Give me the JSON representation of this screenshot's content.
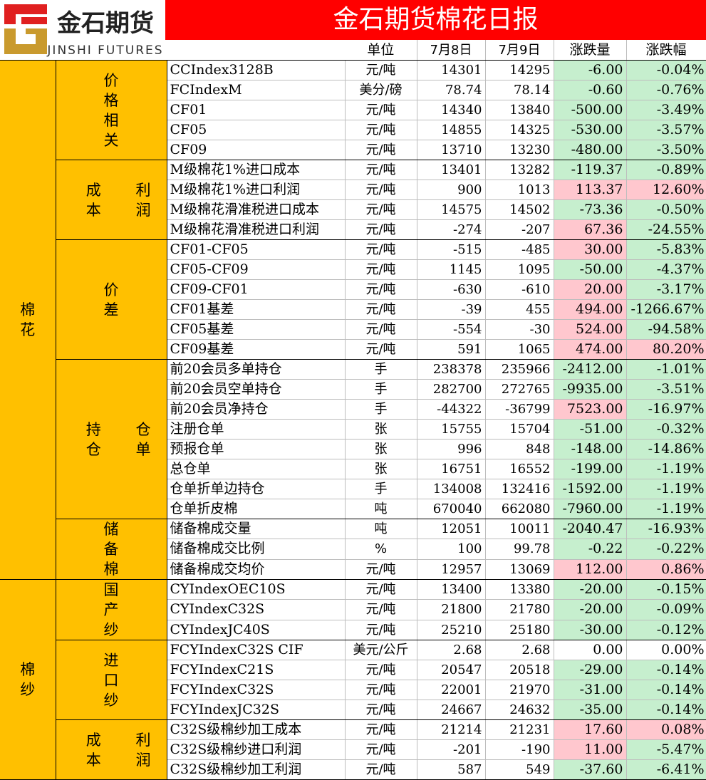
{
  "title": "金石期货棉花日报",
  "logo": {
    "text": "金石期货",
    "sub": "JINSHI FUTURES"
  },
  "colors": {
    "title_bg": "#ff0000",
    "category_bg": "#ffc000",
    "up_bg": "#ffc7ce",
    "down_bg": "#c6efce"
  },
  "headers": {
    "unit": "单位",
    "d1": "7月8日",
    "d2": "7月9日",
    "chg": "涨跌量",
    "pct": "涨跌幅"
  },
  "categories": [
    {
      "label": "棉花",
      "groups": [
        {
          "label": "价格相关",
          "layout": "vertical",
          "rows": [
            {
              "name": "CCIndex3128B",
              "unit": "元/吨",
              "d1": "14301",
              "d2": "14295",
              "chg": "-6.00",
              "pct": "-0.04%",
              "chg_dir": "down",
              "pct_dir": "down"
            },
            {
              "name": "FCIndexM",
              "unit": "美分/磅",
              "d1": "78.74",
              "d2": "78.14",
              "chg": "-0.60",
              "pct": "-0.76%",
              "chg_dir": "down",
              "pct_dir": "down"
            },
            {
              "name": "CF01",
              "unit": "元/吨",
              "d1": "14340",
              "d2": "13840",
              "chg": "-500.00",
              "pct": "-3.49%",
              "chg_dir": "down",
              "pct_dir": "down"
            },
            {
              "name": "CF05",
              "unit": "元/吨",
              "d1": "14855",
              "d2": "14325",
              "chg": "-530.00",
              "pct": "-3.57%",
              "chg_dir": "down",
              "pct_dir": "down"
            },
            {
              "name": "CF09",
              "unit": "元/吨",
              "d1": "13710",
              "d2": "13230",
              "chg": "-480.00",
              "pct": "-3.50%",
              "chg_dir": "down",
              "pct_dir": "down"
            }
          ]
        },
        {
          "label": "成利本润",
          "layout": "grid",
          "rows": [
            {
              "name": "M级棉花1%进口成本",
              "unit": "元/吨",
              "d1": "13401",
              "d2": "13282",
              "chg": "-119.37",
              "pct": "-0.89%",
              "chg_dir": "down",
              "pct_dir": "down"
            },
            {
              "name": "M级棉花1%进口利润",
              "unit": "元/吨",
              "d1": "900",
              "d2": "1013",
              "chg": "113.37",
              "pct": "12.60%",
              "chg_dir": "up",
              "pct_dir": "up"
            },
            {
              "name": "M级棉花滑准税进口成本",
              "unit": "元/吨",
              "d1": "14575",
              "d2": "14502",
              "chg": "-73.36",
              "pct": "-0.50%",
              "chg_dir": "down",
              "pct_dir": "down"
            },
            {
              "name": "M级棉花滑准税进口利润",
              "unit": "元/吨",
              "d1": "-274",
              "d2": "-207",
              "chg": "67.36",
              "pct": "-24.55%",
              "chg_dir": "up",
              "pct_dir": "down"
            }
          ]
        },
        {
          "label": "价差",
          "layout": "vertical",
          "rows": [
            {
              "name": "CF01-CF05",
              "unit": "元/吨",
              "d1": "-515",
              "d2": "-485",
              "chg": "30.00",
              "pct": "-5.83%",
              "chg_dir": "up",
              "pct_dir": "down"
            },
            {
              "name": "CF05-CF09",
              "unit": "元/吨",
              "d1": "1145",
              "d2": "1095",
              "chg": "-50.00",
              "pct": "-4.37%",
              "chg_dir": "down",
              "pct_dir": "down"
            },
            {
              "name": "CF09-CF01",
              "unit": "元/吨",
              "d1": "-630",
              "d2": "-610",
              "chg": "20.00",
              "pct": "-3.17%",
              "chg_dir": "up",
              "pct_dir": "down"
            },
            {
              "name": "CF01基差",
              "unit": "元/吨",
              "d1": "-39",
              "d2": "455",
              "chg": "494.00",
              "pct": "-1266.67%",
              "chg_dir": "up",
              "pct_dir": "down"
            },
            {
              "name": "CF05基差",
              "unit": "元/吨",
              "d1": "-554",
              "d2": "-30",
              "chg": "524.00",
              "pct": "-94.58%",
              "chg_dir": "up",
              "pct_dir": "down"
            },
            {
              "name": "CF09基差",
              "unit": "元/吨",
              "d1": "591",
              "d2": "1065",
              "chg": "474.00",
              "pct": "80.20%",
              "chg_dir": "up",
              "pct_dir": "up"
            }
          ]
        },
        {
          "label": "持仓仓单",
          "layout": "grid",
          "rows": [
            {
              "name": "前20会员多单持仓",
              "unit": "手",
              "d1": "238378",
              "d2": "235966",
              "chg": "-2412.00",
              "pct": "-1.01%",
              "chg_dir": "down",
              "pct_dir": "down"
            },
            {
              "name": "前20会员空单持仓",
              "unit": "手",
              "d1": "282700",
              "d2": "272765",
              "chg": "-9935.00",
              "pct": "-3.51%",
              "chg_dir": "down",
              "pct_dir": "down"
            },
            {
              "name": "前20会员净持仓",
              "unit": "手",
              "d1": "-44322",
              "d2": "-36799",
              "chg": "7523.00",
              "pct": "-16.97%",
              "chg_dir": "up",
              "pct_dir": "down"
            },
            {
              "name": "注册仓单",
              "unit": "张",
              "d1": "15755",
              "d2": "15704",
              "chg": "-51.00",
              "pct": "-0.32%",
              "chg_dir": "down",
              "pct_dir": "down"
            },
            {
              "name": "预报仓单",
              "unit": "张",
              "d1": "996",
              "d2": "848",
              "chg": "-148.00",
              "pct": "-14.86%",
              "chg_dir": "down",
              "pct_dir": "down"
            },
            {
              "name": "总仓单",
              "unit": "张",
              "d1": "16751",
              "d2": "16552",
              "chg": "-199.00",
              "pct": "-1.19%",
              "chg_dir": "down",
              "pct_dir": "down"
            },
            {
              "name": "仓单折单边持仓",
              "unit": "手",
              "d1": "134008",
              "d2": "132416",
              "chg": "-1592.00",
              "pct": "-1.19%",
              "chg_dir": "down",
              "pct_dir": "down"
            },
            {
              "name": "仓单折皮棉",
              "unit": "吨",
              "d1": "670040",
              "d2": "662080",
              "chg": "-7960.00",
              "pct": "-1.19%",
              "chg_dir": "down",
              "pct_dir": "down"
            }
          ]
        },
        {
          "label": "储备棉",
          "layout": "vertical",
          "rows": [
            {
              "name": "储备棉成交量",
              "unit": "吨",
              "d1": "12051",
              "d2": "10011",
              "chg": "-2040.47",
              "pct": "-16.93%",
              "chg_dir": "down",
              "pct_dir": "down"
            },
            {
              "name": "储备棉成交比例",
              "unit": "%",
              "d1": "100",
              "d2": "99.78",
              "chg": "-0.22",
              "pct": "-0.22%",
              "chg_dir": "down",
              "pct_dir": "down"
            },
            {
              "name": "储备棉成交均价",
              "unit": "元/吨",
              "d1": "12957",
              "d2": "13069",
              "chg": "112.00",
              "pct": "0.86%",
              "chg_dir": "up",
              "pct_dir": "up"
            }
          ]
        }
      ]
    },
    {
      "label": "棉纱",
      "groups": [
        {
          "label": "国产纱",
          "layout": "vertical",
          "rows": [
            {
              "name": "CYIndexOEC10S",
              "unit": "元/吨",
              "d1": "13400",
              "d2": "13380",
              "chg": "-20.00",
              "pct": "-0.15%",
              "chg_dir": "down",
              "pct_dir": "down"
            },
            {
              "name": "CYIndexC32S",
              "unit": "元/吨",
              "d1": "21800",
              "d2": "21780",
              "chg": "-20.00",
              "pct": "-0.09%",
              "chg_dir": "down",
              "pct_dir": "down"
            },
            {
              "name": "CYIndexJC40S",
              "unit": "元/吨",
              "d1": "25210",
              "d2": "25180",
              "chg": "-30.00",
              "pct": "-0.12%",
              "chg_dir": "down",
              "pct_dir": "down"
            }
          ]
        },
        {
          "label": "进口纱",
          "layout": "vertical",
          "rows": [
            {
              "name": "FCYIndexC32S CIF",
              "unit": "美元/公斤",
              "d1": "2.68",
              "d2": "2.68",
              "chg": "0.00",
              "pct": "0.00%",
              "chg_dir": "none",
              "pct_dir": "none"
            },
            {
              "name": "FCYIndexC21S",
              "unit": "元/吨",
              "d1": "20547",
              "d2": "20518",
              "chg": "-29.00",
              "pct": "-0.14%",
              "chg_dir": "down",
              "pct_dir": "down"
            },
            {
              "name": "FCYIndexC32S",
              "unit": "元/吨",
              "d1": "22001",
              "d2": "21970",
              "chg": "-31.00",
              "pct": "-0.14%",
              "chg_dir": "down",
              "pct_dir": "down"
            },
            {
              "name": "FCYIndexJC32S",
              "unit": "元/吨",
              "d1": "24667",
              "d2": "24632",
              "chg": "-35.00",
              "pct": "-0.14%",
              "chg_dir": "down",
              "pct_dir": "down"
            }
          ]
        },
        {
          "label": "成利本润",
          "layout": "grid",
          "rows": [
            {
              "name": "C32S级棉纱加工成本",
              "unit": "元/吨",
              "d1": "21214",
              "d2": "21231",
              "chg": "17.60",
              "pct": "0.08%",
              "chg_dir": "up",
              "pct_dir": "up"
            },
            {
              "name": "C32S级棉纱进口利润",
              "unit": "元/吨",
              "d1": "-201",
              "d2": "-190",
              "chg": "11.00",
              "pct": "-5.47%",
              "chg_dir": "up",
              "pct_dir": "down"
            },
            {
              "name": "C32S级棉纱加工利润",
              "unit": "元/吨",
              "d1": "587",
              "d2": "549",
              "chg": "-37.60",
              "pct": "-6.41%",
              "chg_dir": "down",
              "pct_dir": "down"
            }
          ]
        }
      ]
    }
  ]
}
